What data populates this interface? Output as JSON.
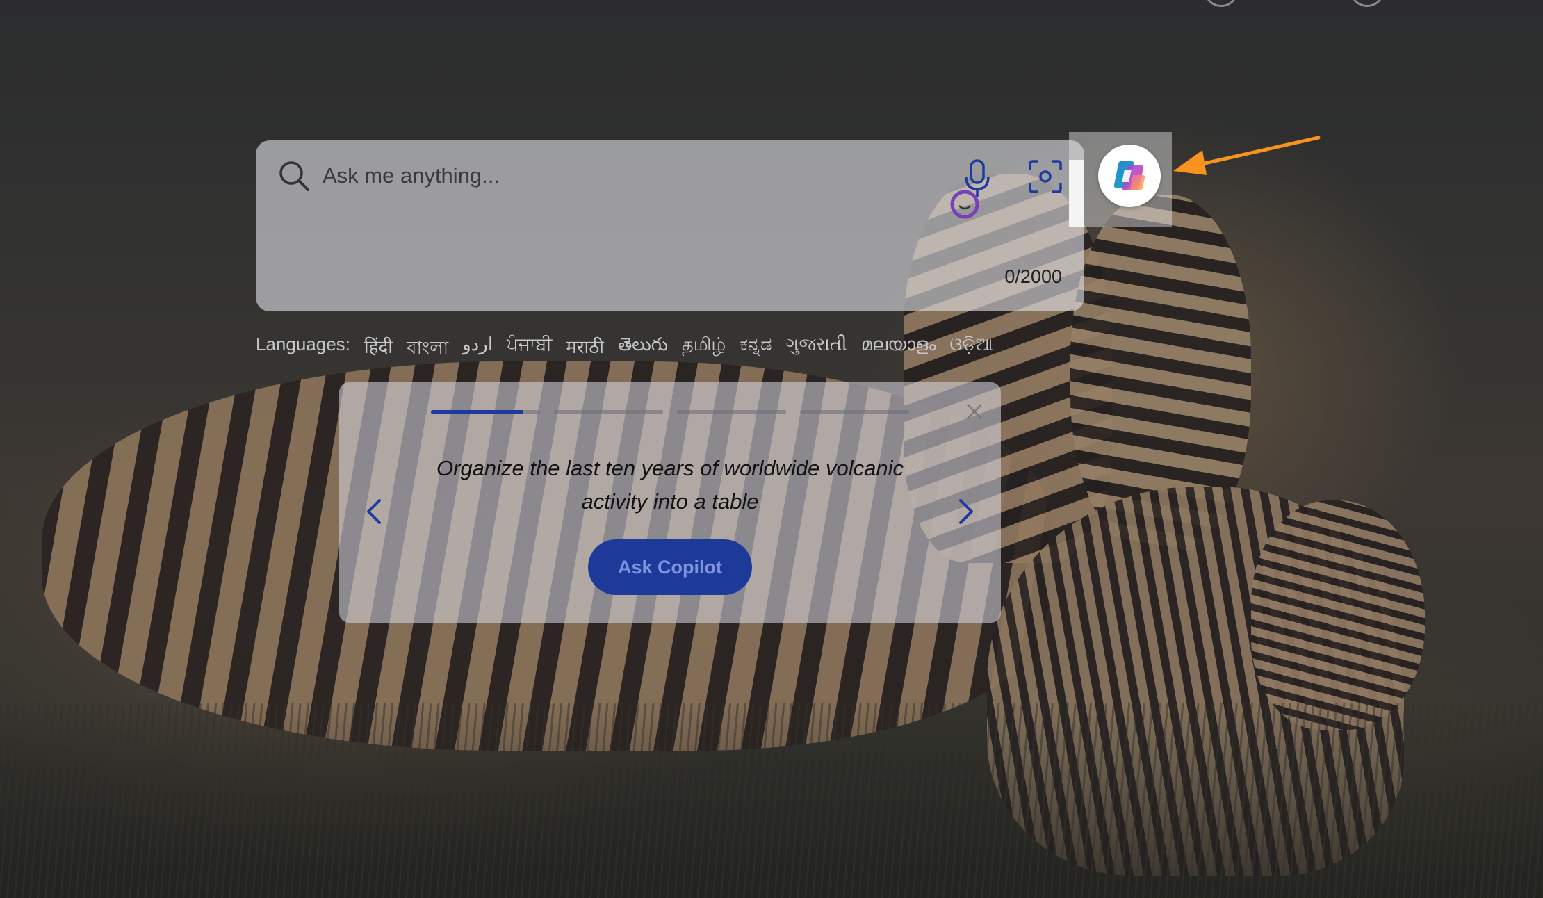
{
  "search": {
    "placeholder": "Ask me anything...",
    "char_count": "0/2000"
  },
  "languages": {
    "label": "Languages:",
    "items": [
      "हिंदी",
      "বাংলা",
      "اردو",
      "ਪੰਜਾਬੀ",
      "मराठी",
      "తెలుగు",
      "தமிழ்",
      "ಕನ್ನಡ",
      "ગુજરાતી",
      "മലയാളം",
      "ଓଡ଼ିଆ"
    ]
  },
  "suggestion_card": {
    "prompt": "Organize the last ten years of worldwide volcanic activity into a table",
    "button_label": "Ask Copilot",
    "progress_fill": [
      0.85,
      0,
      0,
      0
    ]
  },
  "colors": {
    "accent": "#1d3a98",
    "annotation_arrow": "#f7931e"
  },
  "icons": [
    "search-icon",
    "microphone-icon",
    "visual-search-icon",
    "persona-icon",
    "copilot-logo-icon",
    "close-icon",
    "chevron-left-icon",
    "chevron-right-icon",
    "annotation-arrow-icon"
  ]
}
